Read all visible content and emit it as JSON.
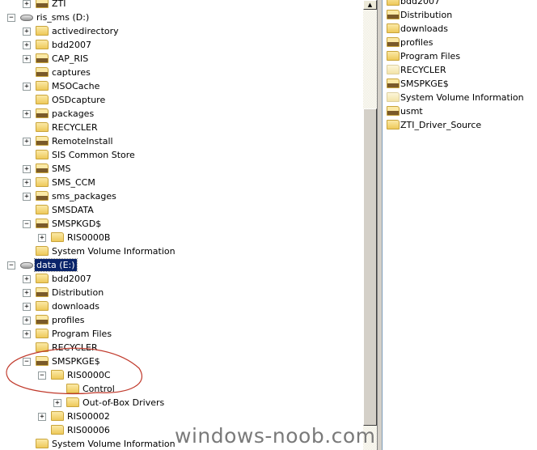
{
  "tree": [
    {
      "label": "ZTI",
      "level": 1,
      "exp": "+",
      "icon": "shared"
    },
    {
      "label": "ris_sms (D:)",
      "level": 0,
      "exp": "-",
      "icon": "drive"
    },
    {
      "label": "activedirectory",
      "level": 1,
      "exp": "+",
      "icon": "folder"
    },
    {
      "label": "bdd2007",
      "level": 1,
      "exp": "+",
      "icon": "folder"
    },
    {
      "label": "CAP_RIS",
      "level": 1,
      "exp": "+",
      "icon": "shared"
    },
    {
      "label": "captures",
      "level": 1,
      "exp": "",
      "icon": "shared"
    },
    {
      "label": "MSOCache",
      "level": 1,
      "exp": "+",
      "icon": "folder"
    },
    {
      "label": "OSDcapture",
      "level": 1,
      "exp": "",
      "icon": "folder"
    },
    {
      "label": "packages",
      "level": 1,
      "exp": "+",
      "icon": "shared"
    },
    {
      "label": "RECYCLER",
      "level": 1,
      "exp": "",
      "icon": "folder"
    },
    {
      "label": "RemoteInstall",
      "level": 1,
      "exp": "+",
      "icon": "shared"
    },
    {
      "label": "SIS Common Store",
      "level": 1,
      "exp": "",
      "icon": "folder"
    },
    {
      "label": "SMS",
      "level": 1,
      "exp": "+",
      "icon": "shared"
    },
    {
      "label": "SMS_CCM",
      "level": 1,
      "exp": "+",
      "icon": "folder"
    },
    {
      "label": "sms_packages",
      "level": 1,
      "exp": "+",
      "icon": "shared"
    },
    {
      "label": "SMSDATA",
      "level": 1,
      "exp": "",
      "icon": "folder"
    },
    {
      "label": "SMSPKGD$",
      "level": 1,
      "exp": "-",
      "icon": "shared"
    },
    {
      "label": "RIS0000B",
      "level": 2,
      "exp": "+",
      "icon": "folder"
    },
    {
      "label": "System Volume Information",
      "level": 1,
      "exp": "",
      "icon": "folder"
    },
    {
      "label": "data (E:)",
      "level": 0,
      "exp": "-",
      "icon": "drive",
      "selected": true
    },
    {
      "label": "bdd2007",
      "level": 1,
      "exp": "+",
      "icon": "folder"
    },
    {
      "label": "Distribution",
      "level": 1,
      "exp": "+",
      "icon": "shared"
    },
    {
      "label": "downloads",
      "level": 1,
      "exp": "+",
      "icon": "folder"
    },
    {
      "label": "profiles",
      "level": 1,
      "exp": "+",
      "icon": "shared"
    },
    {
      "label": "Program Files",
      "level": 1,
      "exp": "+",
      "icon": "folder"
    },
    {
      "label": "RECYCLER",
      "level": 1,
      "exp": "",
      "icon": "folder"
    },
    {
      "label": "SMSPKGE$",
      "level": 1,
      "exp": "-",
      "icon": "shared"
    },
    {
      "label": "RIS0000C",
      "level": 2,
      "exp": "-",
      "icon": "folder"
    },
    {
      "label": "Control",
      "level": 3,
      "exp": "",
      "icon": "folder"
    },
    {
      "label": "Out-of-Box Drivers",
      "level": 3,
      "exp": "+",
      "icon": "folder"
    },
    {
      "label": "RIS00002",
      "level": 2,
      "exp": "+",
      "icon": "folder"
    },
    {
      "label": "RIS00006",
      "level": 2,
      "exp": "",
      "icon": "folder"
    },
    {
      "label": "System Volume Information",
      "level": 1,
      "exp": "",
      "icon": "folder"
    }
  ],
  "list": [
    {
      "label": "bdd2007",
      "icon": "folder"
    },
    {
      "label": "Distribution",
      "icon": "shared"
    },
    {
      "label": "downloads",
      "icon": "folder"
    },
    {
      "label": "profiles",
      "icon": "shared"
    },
    {
      "label": "Program Files",
      "icon": "folder"
    },
    {
      "label": "RECYCLER",
      "icon": "dim"
    },
    {
      "label": "SMSPKGE$",
      "icon": "shared"
    },
    {
      "label": "System Volume Information",
      "icon": "dim"
    },
    {
      "label": "usmt",
      "icon": "shared"
    },
    {
      "label": "ZTI_Driver_Source",
      "icon": "folder"
    }
  ],
  "watermark": "windows-noob.com",
  "annotation_color": "#c0392b",
  "selection_color": "#0a246a"
}
